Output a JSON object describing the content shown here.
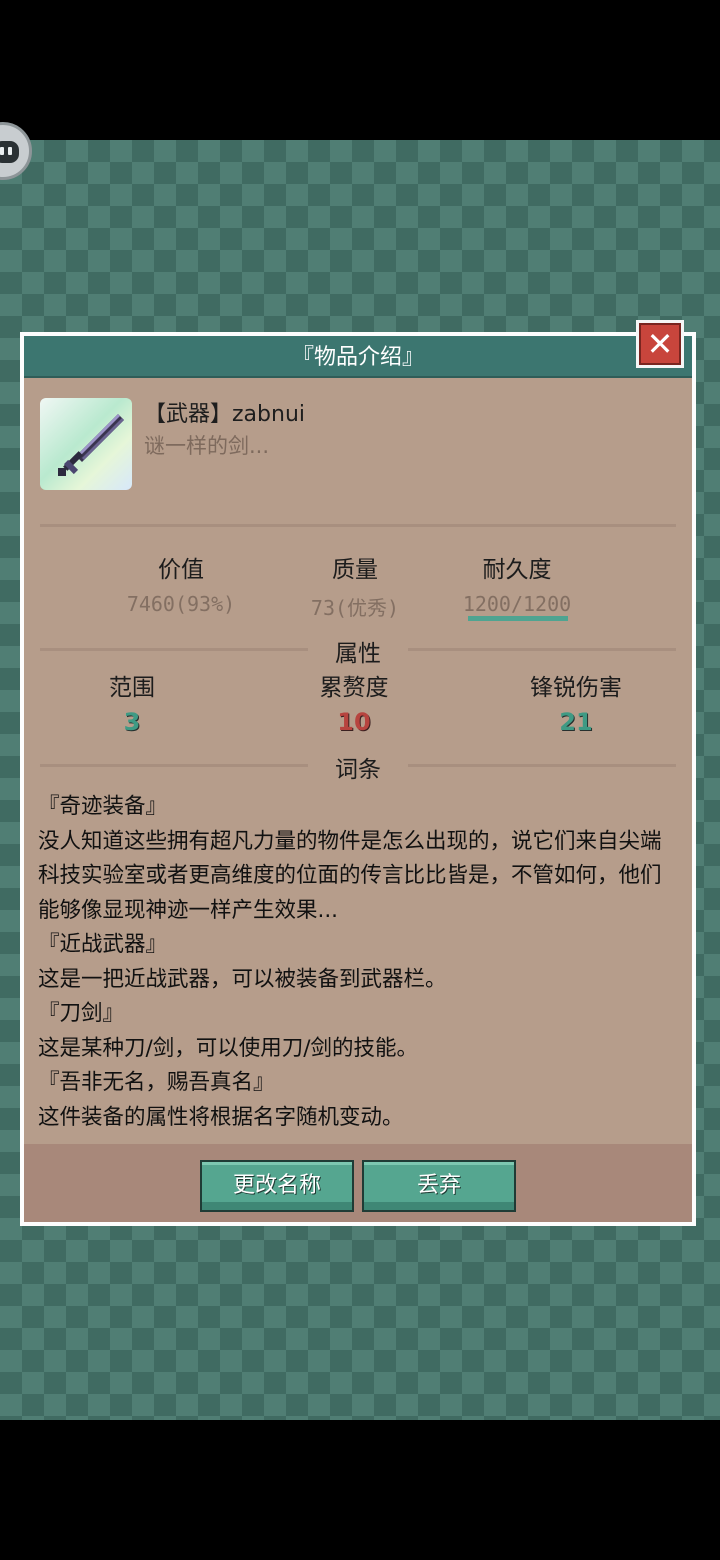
{
  "dialog": {
    "title": "『物品介绍』",
    "close_symbol": "✕"
  },
  "item": {
    "icon": "sword-icon",
    "name": "【武器】zabnui",
    "description": "谜一样的剑..."
  },
  "stats": [
    {
      "label": "价值",
      "value": "7460(93%)"
    },
    {
      "label": "质量",
      "value": "73(优秀)"
    },
    {
      "label": "耐久度",
      "value": "1200/1200"
    }
  ],
  "durability_fraction": 1.0,
  "attributes": {
    "section_title": "属性",
    "items": [
      {
        "label": "范围",
        "value": "3"
      },
      {
        "label": "累赘度",
        "value": "10"
      },
      {
        "label": "锋锐伤害",
        "value": "21"
      }
    ]
  },
  "entries": {
    "section_title": "词条",
    "list": [
      {
        "title": "『奇迹装备』",
        "body": "没人知道这些拥有超凡力量的物件是怎么出现的，说它们来自尖端科技实验室或者更高维度的位面的传言比比皆是，不管如何，他们能够像显现神迹一样产生效果..."
      },
      {
        "title": "『近战武器』",
        "body": "这是一把近战武器，可以被装备到武器栏。"
      },
      {
        "title": "『刀剑』",
        "body": "这是某种刀/剑，可以使用刀/剑的技能。"
      },
      {
        "title": "『吾非无名，赐吾真名』",
        "body": "这件装备的属性将根据名字随机变动。"
      }
    ]
  },
  "buttons": {
    "rename": "更改名称",
    "discard": "丢弃"
  },
  "colors": {
    "title_bar": "#3c7670",
    "panel": "#b69d8b",
    "button": "#55a690",
    "stat_green": "#3f9a84",
    "stat_red": "#b7443f"
  }
}
